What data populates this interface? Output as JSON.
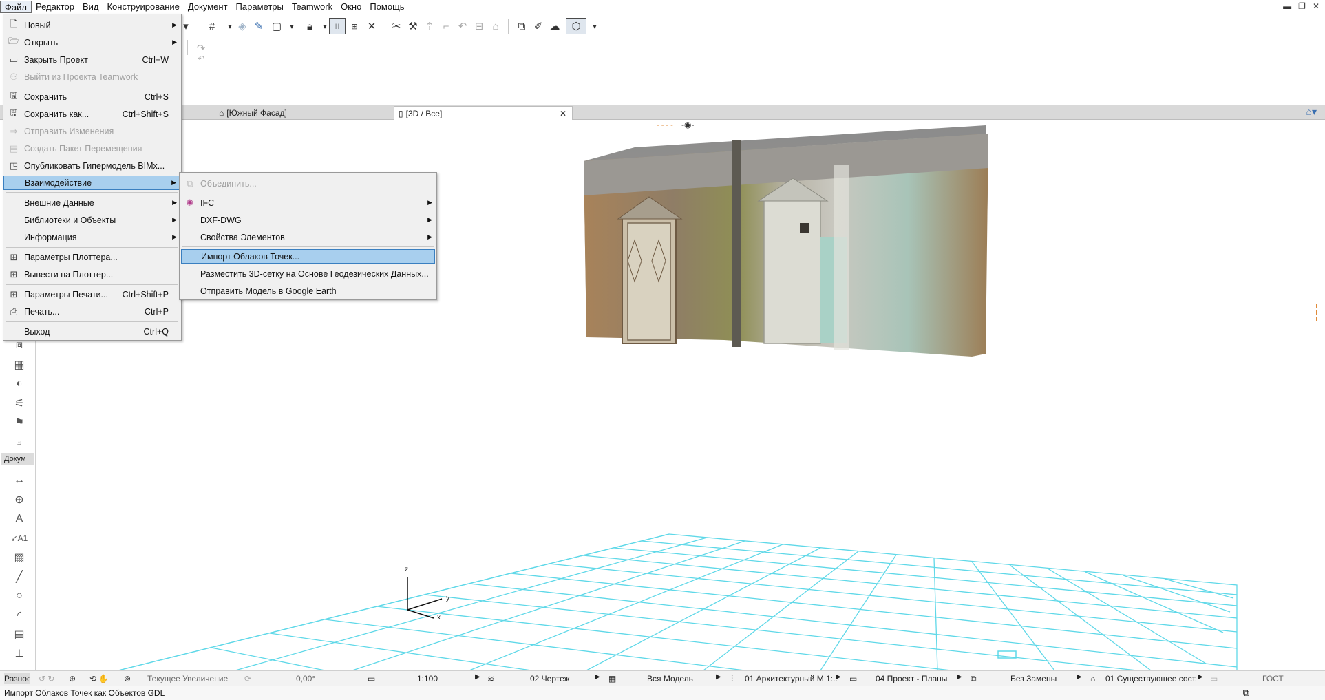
{
  "menubar": {
    "items": [
      "Файл",
      "Редактор",
      "Вид",
      "Конструирование",
      "Документ",
      "Параметры",
      "Teamwork",
      "Окно",
      "Помощь"
    ],
    "window_controls": [
      "▬",
      "❐",
      "✕"
    ]
  },
  "tabs": {
    "items": [
      {
        "label": "[Южный Фасад]",
        "icon": "facade-icon"
      },
      {
        "label": "[3D / Все]",
        "icon": "3d-view-icon",
        "close": "✕"
      }
    ]
  },
  "toolbox": {
    "doc_label": "Докум"
  },
  "viewport": {
    "axis_z": "z",
    "axis_y": "y",
    "axis_x": "x",
    "grid_color": "#5fd8e8"
  },
  "file_menu": {
    "items": [
      {
        "label": "Новый",
        "icon": "new-file-icon",
        "shortcut": "",
        "submenu": true,
        "disabled": false
      },
      {
        "label": "Открыть",
        "icon": "open-folder-icon",
        "shortcut": "",
        "submenu": true,
        "disabled": false
      },
      {
        "label": "Закрыть Проект",
        "icon": "close-project-icon",
        "shortcut": "Ctrl+W",
        "submenu": false,
        "disabled": false
      },
      {
        "label": "Выйти из Проекта Teamwork",
        "icon": "teamwork-exit-icon",
        "shortcut": "",
        "submenu": false,
        "disabled": true
      },
      {
        "label": "Сохранить",
        "icon": "save-icon",
        "shortcut": "Ctrl+S",
        "submenu": false,
        "disabled": false
      },
      {
        "label": "Сохранить как...",
        "icon": "save-as-icon",
        "shortcut": "Ctrl+Shift+S",
        "submenu": false,
        "disabled": false
      },
      {
        "label": "Отправить Изменения",
        "icon": "send-changes-icon",
        "shortcut": "",
        "submenu": false,
        "disabled": true
      },
      {
        "label": "Создать Пакет Перемещения",
        "icon": "package-icon",
        "shortcut": "",
        "submenu": false,
        "disabled": true
      },
      {
        "label": "Опубликовать Гипермодель BIMx...",
        "icon": "bimx-icon",
        "shortcut": "",
        "submenu": false,
        "disabled": false
      },
      {
        "label": "Взаимодействие",
        "icon": "",
        "shortcut": "",
        "submenu": true,
        "disabled": false,
        "highlight": true
      },
      {
        "label": "Внешние Данные",
        "icon": "",
        "shortcut": "",
        "submenu": true,
        "disabled": false
      },
      {
        "label": "Библиотеки и Объекты",
        "icon": "",
        "shortcut": "",
        "submenu": true,
        "disabled": false
      },
      {
        "label": "Информация",
        "icon": "",
        "shortcut": "",
        "submenu": true,
        "disabled": false
      },
      {
        "label": "Параметры Плоттера...",
        "icon": "plotter-setup-icon",
        "shortcut": "",
        "submenu": false,
        "disabled": false
      },
      {
        "label": "Вывести на Плоттер...",
        "icon": "plot-icon",
        "shortcut": "",
        "submenu": false,
        "disabled": false
      },
      {
        "label": "Параметры Печати...",
        "icon": "print-setup-icon",
        "shortcut": "Ctrl+Shift+P",
        "submenu": false,
        "disabled": false
      },
      {
        "label": "Печать...",
        "icon": "printer-icon",
        "shortcut": "Ctrl+P",
        "submenu": false,
        "disabled": false
      },
      {
        "label": "Выход",
        "icon": "",
        "shortcut": "Ctrl+Q",
        "submenu": false,
        "disabled": false
      }
    ]
  },
  "interop_submenu": {
    "items": [
      {
        "label": "Объединить...",
        "icon": "merge-icon",
        "submenu": false,
        "disabled": true
      },
      {
        "label": "IFC",
        "icon": "ifc-icon",
        "submenu": true,
        "disabled": false
      },
      {
        "label": "DXF-DWG",
        "icon": "",
        "submenu": true,
        "disabled": false
      },
      {
        "label": "Свойства Элементов",
        "icon": "",
        "submenu": true,
        "disabled": false
      },
      {
        "label": "Импорт Облаков Точек...",
        "icon": "",
        "submenu": false,
        "disabled": false,
        "highlight": true
      },
      {
        "label": "Разместить 3D-сетку на Основе Геодезических Данных...",
        "icon": "",
        "submenu": false,
        "disabled": false
      },
      {
        "label": "Отправить Модель в Google Earth",
        "icon": "",
        "submenu": false,
        "disabled": false
      }
    ]
  },
  "statusbar": {
    "left_label": "Разное",
    "zoom_label": "Текущее Увеличение",
    "angle": "0,00°",
    "scale": "1:100",
    "layer_combo": "02 Чертеж",
    "model_view": "Вся Модель",
    "pen_set": "01 Архитектурный М 1:...",
    "mvo": "04 Проект - Планы",
    "override": "Без Замены",
    "renovation": "01 Существующее сост...",
    "standard": "ГОСТ"
  },
  "hint": {
    "text": "Импорт Облаков Точек как Объектов GDL"
  },
  "colors": {
    "menu_highlight": "#a8cfee",
    "menu_highlight_border": "#3a7fc0",
    "grid": "#5fd8e8"
  }
}
